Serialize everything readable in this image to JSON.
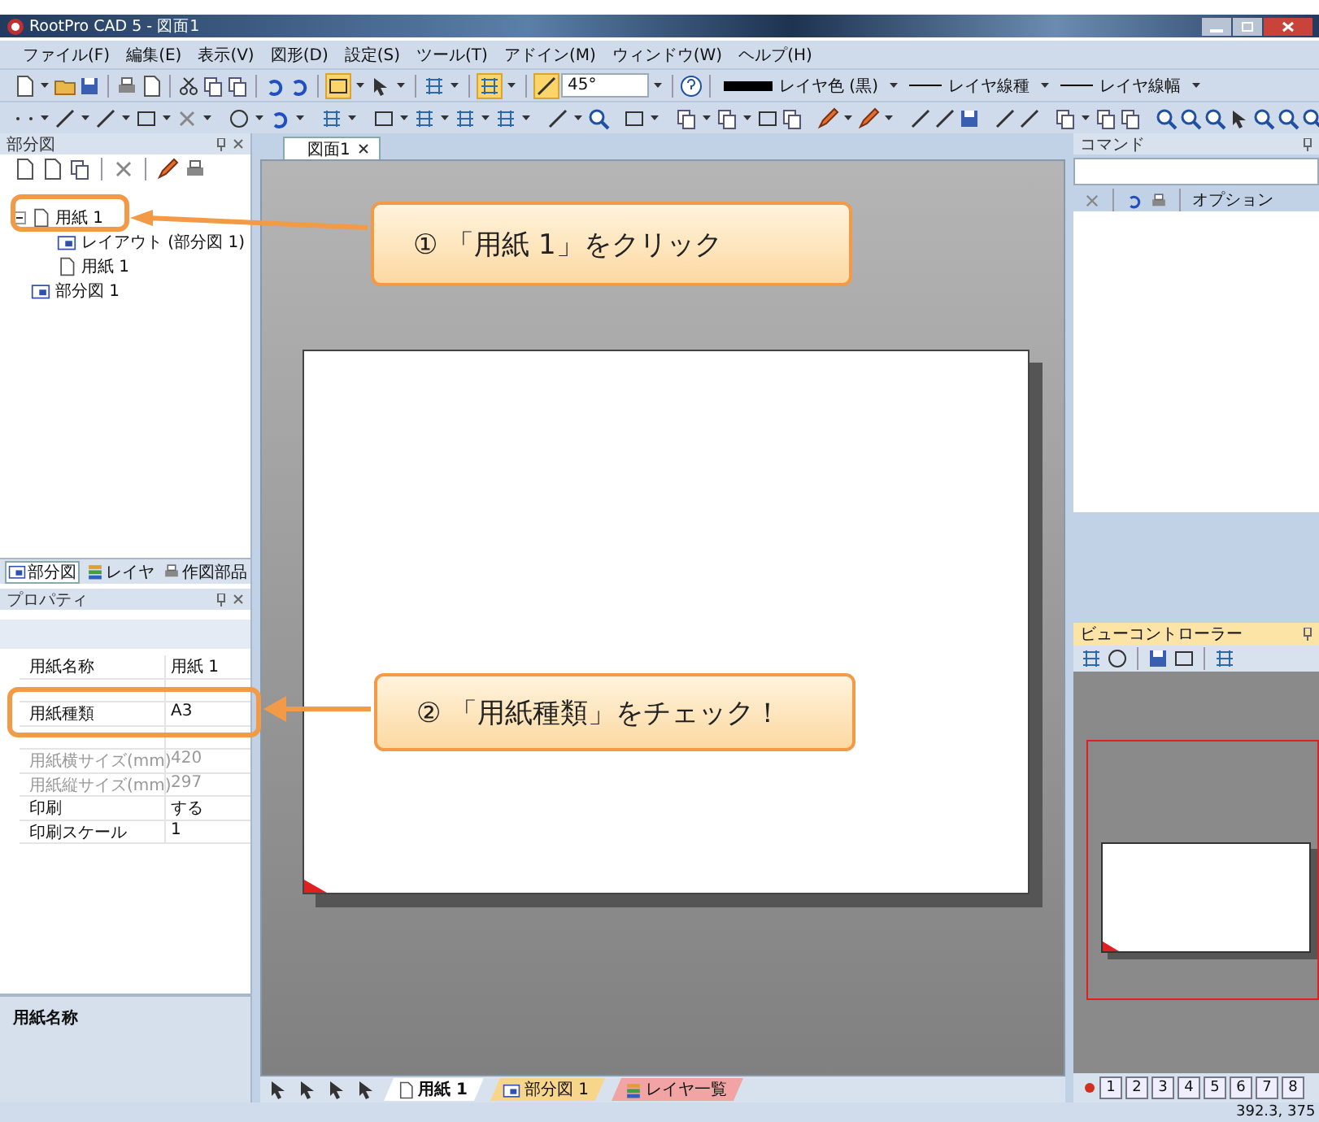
{
  "window": {
    "title": "RootPro CAD 5 - 図面1"
  },
  "menu": [
    "ファイル(F)",
    "編集(E)",
    "表示(V)",
    "図形(D)",
    "設定(S)",
    "ツール(T)",
    "アドイン(M)",
    "ウィンドウ(W)",
    "ヘルプ(H)"
  ],
  "toolbar": {
    "angle": "45°",
    "layer_color": "レイヤ色 (黒)",
    "line_type": "レイヤ線種",
    "line_width": "レイヤ線幅"
  },
  "parts_panel": {
    "title": "部分図",
    "tree": [
      {
        "label": "用紙 1",
        "kind": "paper",
        "expanded": true,
        "children": [
          {
            "label": "レイアウト (部分図 1)",
            "kind": "layout"
          },
          {
            "label": "用紙 1",
            "kind": "paper"
          }
        ]
      },
      {
        "label": "部分図 1",
        "kind": "part"
      }
    ],
    "tabs": [
      {
        "label": "部分図",
        "selected": true
      },
      {
        "label": "レイヤ",
        "selected": false
      },
      {
        "label": "作図部品",
        "selected": false
      }
    ]
  },
  "properties": {
    "title": "プロパティ",
    "rows": [
      {
        "kind": "field",
        "name": "用紙名称",
        "value": "用紙 1",
        "disabled": false
      },
      {
        "kind": "covered"
      },
      {
        "kind": "field",
        "name": "用紙種類",
        "value": "A3",
        "disabled": false
      },
      {
        "kind": "covered"
      },
      {
        "kind": "field",
        "name": "用紙横サイズ(mm)",
        "value": "420",
        "disabled": true
      },
      {
        "kind": "field",
        "name": "用紙縦サイズ(mm)",
        "value": "297",
        "disabled": true
      },
      {
        "kind": "field",
        "name": "印刷",
        "value": "する",
        "disabled": false
      },
      {
        "kind": "field",
        "name": "印刷スケール",
        "value": "1",
        "disabled": false
      }
    ],
    "description": "用紙名称"
  },
  "document_tabs": [
    {
      "label": "図面1",
      "selected": true
    }
  ],
  "sheet_tabs": [
    {
      "label": "用紙 1",
      "kind": "paper",
      "color": "#ffffff",
      "selected": true
    },
    {
      "label": "部分図 1",
      "kind": "part",
      "color": "#f7d58a",
      "selected": false
    },
    {
      "label": "レイヤ一覧",
      "kind": "layer",
      "color": "#f2a3a3",
      "selected": false
    }
  ],
  "command": {
    "title": "コマンド",
    "option": "オプション"
  },
  "view_controller": {
    "title": "ビューコントローラー",
    "pages": [
      "1",
      "2",
      "3",
      "4",
      "5",
      "6",
      "7",
      "8"
    ]
  },
  "status_bar": {
    "coordinates": "392.3, 375"
  },
  "callouts": [
    {
      "text": "① 「用紙 1」をクリック"
    },
    {
      "text": "② 「用紙種類」をチェック！"
    }
  ]
}
